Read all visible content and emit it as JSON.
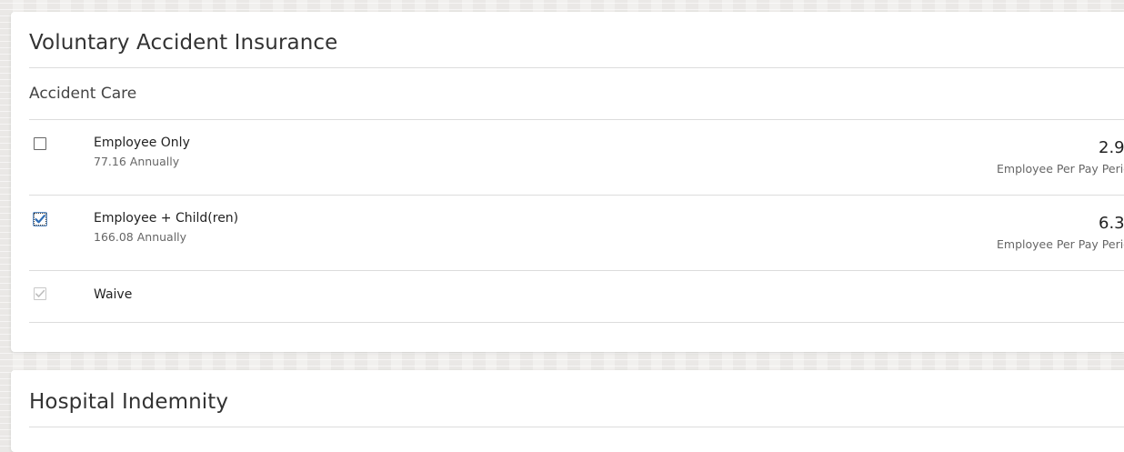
{
  "sections": {
    "accident": {
      "title": "Voluntary Accident Insurance",
      "plan_name": "Accident Care",
      "options": [
        {
          "label": "Employee Only",
          "annual": "77.16",
          "period": "Annually",
          "amount": "2.9",
          "per": "Employee Per Pay Perio",
          "checked": false,
          "disabled": false
        },
        {
          "label": "Employee + Child(ren)",
          "annual": "166.08",
          "period": "Annually",
          "amount": "6.3",
          "per": "Employee Per Pay Perio",
          "checked": true,
          "disabled": false
        },
        {
          "label": "Waive",
          "checked": true,
          "disabled": true
        }
      ]
    },
    "hospital": {
      "title": "Hospital Indemnity"
    }
  },
  "colors": {
    "check_blue": "#2f6db5",
    "check_disabled": "#bdbdbd",
    "divider": "#dcdcdc"
  }
}
